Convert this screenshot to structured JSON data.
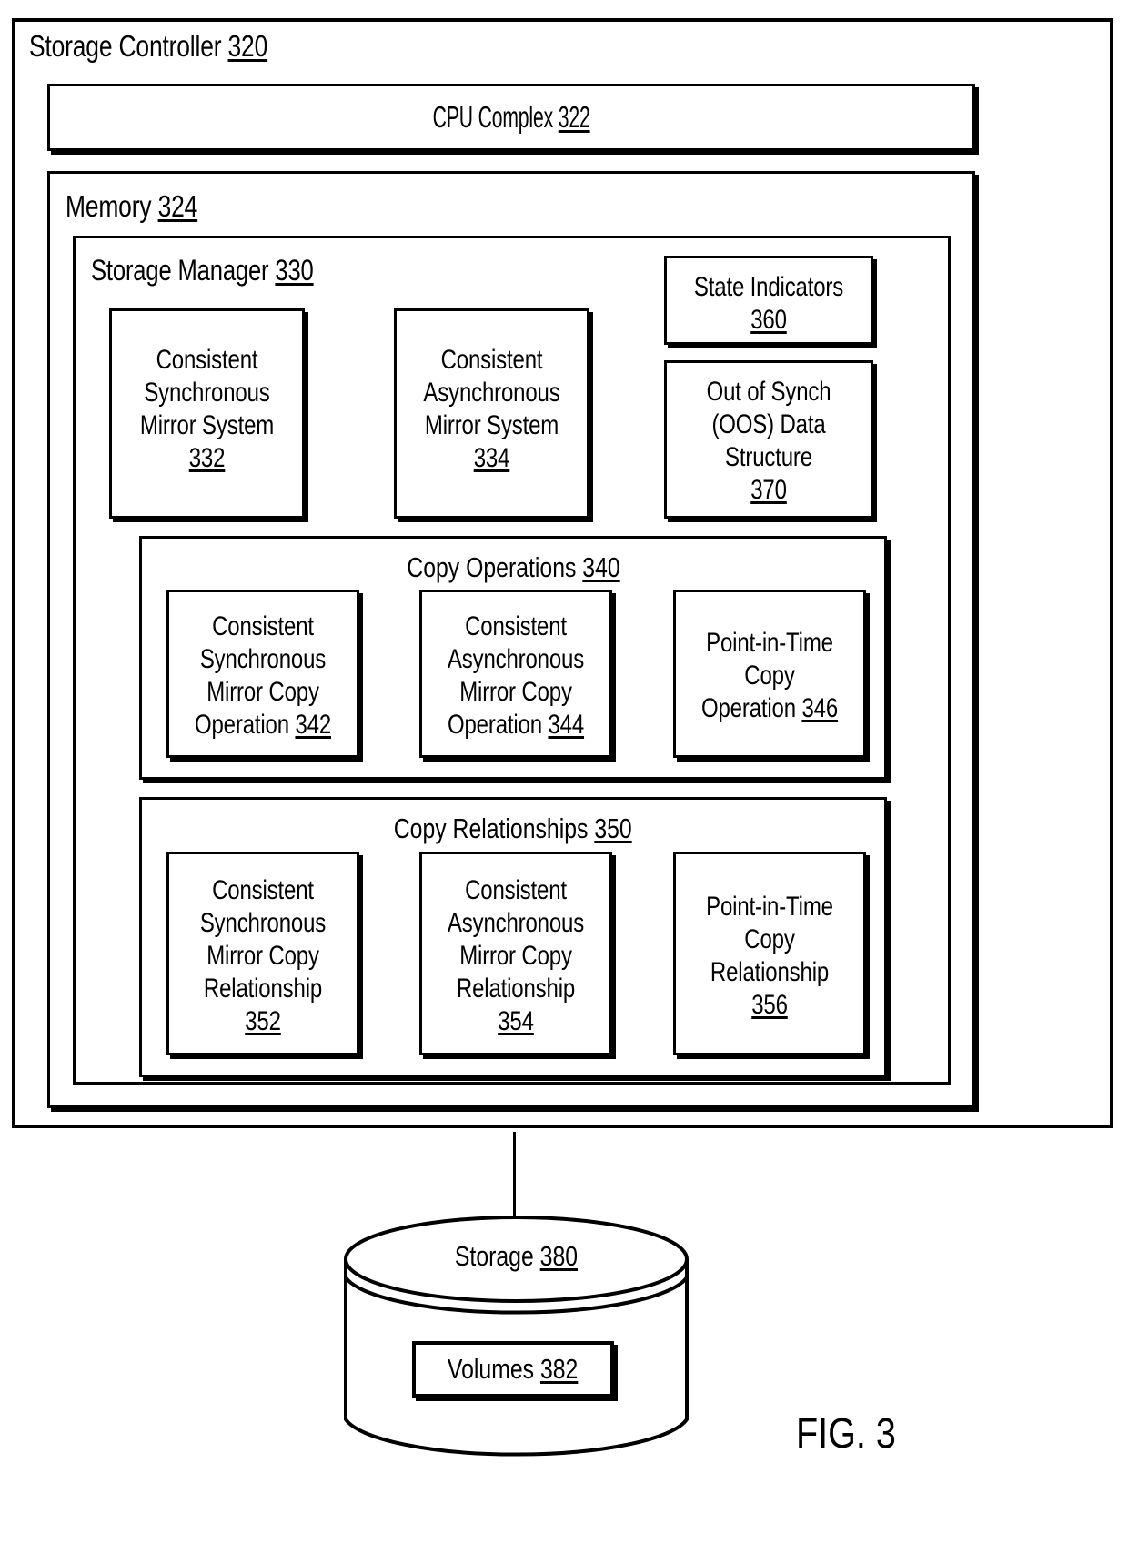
{
  "figure": {
    "caption": "FIG. 3"
  },
  "storage_controller": {
    "title": "Storage Controller",
    "ref": "320"
  },
  "cpu_complex": {
    "title": "CPU Complex",
    "ref": "322"
  },
  "memory": {
    "title": "Memory",
    "ref": "324"
  },
  "storage_manager": {
    "title": "Storage Manager",
    "ref": "330",
    "boxes": [
      {
        "lines": [
          "Consistent",
          "Synchronous",
          "Mirror System"
        ],
        "ref": "332",
        "ref_inline": false
      },
      {
        "lines": [
          "Consistent",
          "Asynchronous",
          "Mirror System"
        ],
        "ref": "334",
        "ref_inline": false
      },
      {
        "lines": [
          "State Indicators"
        ],
        "ref": "360",
        "ref_inline": false
      },
      {
        "lines": [
          "Out of Synch",
          "(OOS) Data",
          "Structure"
        ],
        "ref": "370",
        "ref_inline": false
      }
    ]
  },
  "copy_operations": {
    "title": "Copy Operations",
    "ref": "340",
    "boxes": [
      {
        "lines": [
          "Consistent",
          "Synchronous",
          "Mirror Copy"
        ],
        "last_line": "Operation",
        "ref": "342",
        "ref_inline": true
      },
      {
        "lines": [
          "Consistent",
          "Asynchronous",
          "Mirror Copy"
        ],
        "last_line": "Operation",
        "ref": "344",
        "ref_inline": true
      },
      {
        "lines": [
          "Point-in-Time",
          "Copy"
        ],
        "last_line": "Operation",
        "ref": "346",
        "ref_inline": true
      }
    ]
  },
  "copy_relationships": {
    "title": "Copy Relationships",
    "ref": "350",
    "boxes": [
      {
        "lines": [
          "Consistent",
          "Synchronous",
          "Mirror Copy",
          "Relationship"
        ],
        "ref": "352",
        "ref_inline": false
      },
      {
        "lines": [
          "Consistent",
          "Asynchronous",
          "Mirror Copy",
          "Relationship"
        ],
        "ref": "354",
        "ref_inline": false
      },
      {
        "lines": [
          "Point-in-Time",
          "Copy",
          "Relationship"
        ],
        "ref": "356",
        "ref_inline": false
      }
    ]
  },
  "storage": {
    "title": "Storage",
    "ref": "380",
    "volumes": {
      "title": "Volumes",
      "ref": "382"
    }
  },
  "colors": {
    "line": "#000000",
    "background": "#ffffff"
  }
}
